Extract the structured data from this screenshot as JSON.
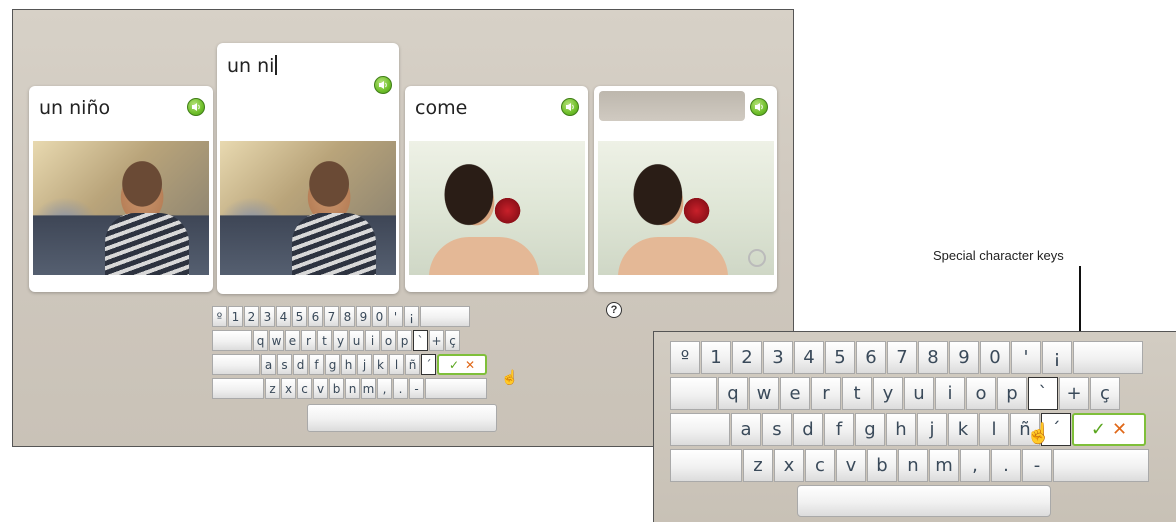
{
  "cards": [
    {
      "text": "un niño",
      "photo": "boy-at-desk",
      "typing": false
    },
    {
      "text": "un ni",
      "photo": "boy-at-desk",
      "typing": true
    },
    {
      "text": "come",
      "photo": "girl-eating-apple",
      "typing": false
    },
    {
      "text": "",
      "photo": "girl-eating-apple",
      "typing": false
    }
  ],
  "keyboard": {
    "row1": [
      "º",
      "1",
      "2",
      "3",
      "4",
      "5",
      "6",
      "7",
      "8",
      "9",
      "0",
      "'",
      "¡",
      ""
    ],
    "row2": [
      "q",
      "w",
      "e",
      "r",
      "t",
      "y",
      "u",
      "i",
      "o",
      "p",
      "`",
      "+",
      "ç"
    ],
    "row3": [
      "a",
      "s",
      "d",
      "f",
      "g",
      "h",
      "j",
      "k",
      "l",
      "ñ",
      "´"
    ],
    "row4": [
      "z",
      "x",
      "c",
      "v",
      "b",
      "n",
      "m",
      ",",
      ".",
      "-"
    ],
    "check_symbol": "✓",
    "cancel_symbol": "✕"
  },
  "help_symbol": "?",
  "callout": {
    "label": "Special character keys"
  },
  "colors": {
    "accent_green": "#6fbf2a",
    "cancel_orange": "#e06818"
  },
  "icons": {
    "speaker": "speaker-icon",
    "help": "help-icon",
    "cursor": "hand-pointer-icon"
  }
}
